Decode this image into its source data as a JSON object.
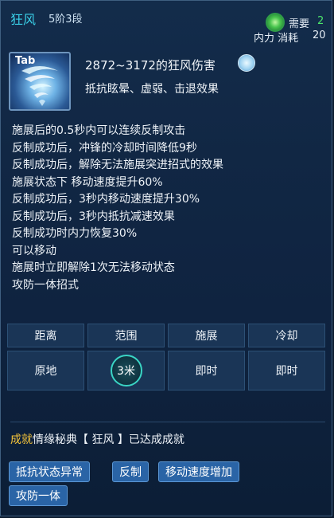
{
  "header": {
    "title": "狂风",
    "level": "5阶3段",
    "need_label": "需要",
    "need_value": "2",
    "cost_label": "内力 消耗",
    "cost_value": "20"
  },
  "skill": {
    "key": "Tab",
    "damage": "2872~3172的狂风伤害",
    "resist": "抵抗眩晕、虚弱、击退效果",
    "icon": "whirlwind-icon",
    "badge_icon": "wind-element-icon"
  },
  "effects": [
    "施展后的0.5秒内可以连续反制攻击",
    "反制成功后，冲锋的冷却时间降低9秒",
    "反制成功后，解除无法施展突进招式的效果",
    "施展状态下 移动速度提升60%",
    "反制成功后，3秒内移动速度提升30%",
    "反制成功后，3秒内抵抗减速效果",
    "反制成功时内力恢复30%",
    "可以移动",
    "施展时立即解除1次无法移动状态",
    "攻防一体招式"
  ],
  "stats": {
    "headers": [
      "距离",
      "范围",
      "施展",
      "冷却"
    ],
    "values": [
      "原地",
      "3米",
      "即时",
      "即时"
    ]
  },
  "achievement": {
    "tag": "成就",
    "text": "情缘秘典【 狂风 】已达成成就"
  },
  "tags": [
    "抵抗状态异常",
    "反制",
    "移动速度增加",
    "攻防一体"
  ],
  "colors": {
    "accent_title": "#3ad0e8",
    "need_value": "#4be46b",
    "achievement_tag": "#f5c43a",
    "tag_bg": "#2a64a6"
  }
}
